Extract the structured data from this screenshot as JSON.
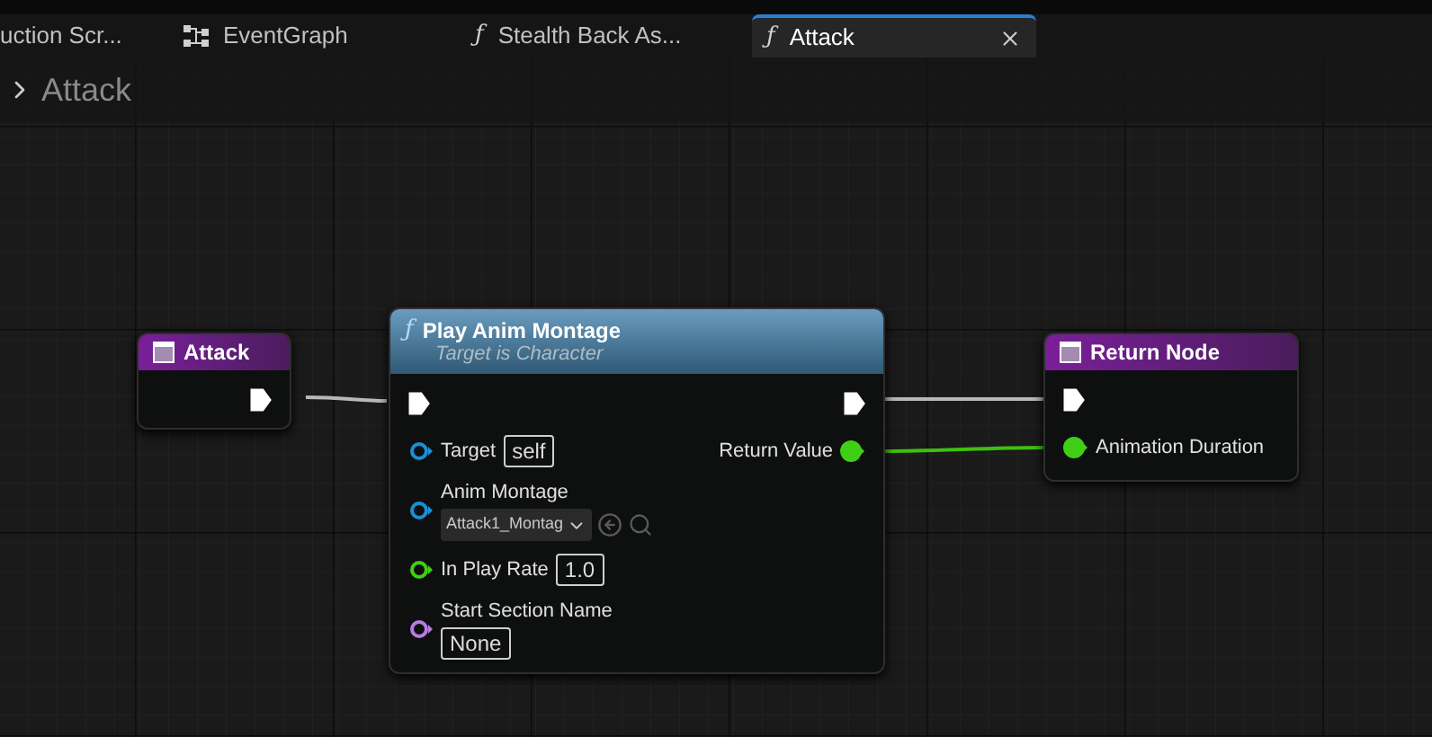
{
  "tabs": [
    {
      "label": "uction Scr...",
      "kind": "plain",
      "selected": false
    },
    {
      "label": "EventGraph",
      "kind": "graph",
      "selected": false
    },
    {
      "label": "Stealth Back As...",
      "kind": "function",
      "glyph": "ƒ",
      "selected": false
    },
    {
      "label": "Attack",
      "kind": "function",
      "glyph": "ƒ",
      "selected": true
    }
  ],
  "breadcrumb": {
    "title": "Attack"
  },
  "nodes": [
    {
      "kind": "entry",
      "title": "Attack",
      "outputs": [
        {
          "kind": "exec",
          "connected": true
        }
      ]
    },
    {
      "kind": "call",
      "glyph": "ƒ",
      "title": "Play Anim Montage",
      "subtitle": "Target is Character",
      "inputs": [
        {
          "kind": "exec",
          "connected": true
        },
        {
          "kind": "object",
          "label": "Target",
          "value": "self",
          "connected": false
        },
        {
          "kind": "asset",
          "label": "Anim Montage",
          "value": "Attack1_Montag",
          "connected": false
        },
        {
          "kind": "float",
          "label": "In Play Rate",
          "value": "1.0",
          "connected": false
        },
        {
          "kind": "name",
          "label": "Start Section Name",
          "value": "None",
          "connected": false
        }
      ],
      "outputs": [
        {
          "kind": "exec",
          "connected": true
        },
        {
          "kind": "float",
          "label": "Return Value",
          "connected": true
        }
      ]
    },
    {
      "kind": "result",
      "title": "Return Node",
      "inputs": [
        {
          "kind": "exec",
          "connected": true
        },
        {
          "kind": "float",
          "label": "Animation Duration",
          "connected": true
        }
      ]
    }
  ]
}
